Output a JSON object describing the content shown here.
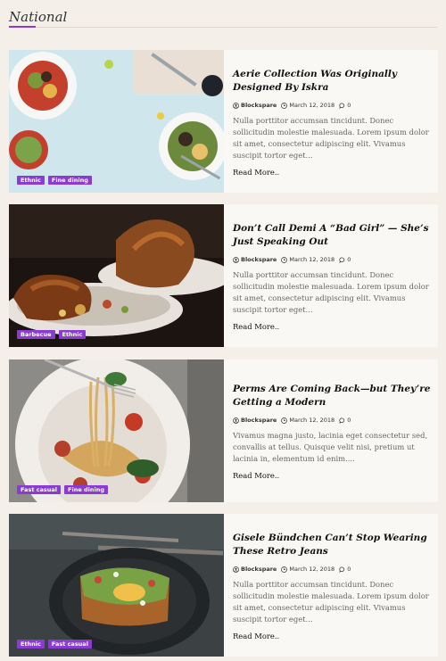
{
  "section": {
    "title": "National"
  },
  "colors": {
    "accent": "#8a3bd1",
    "background": "#f4efe8",
    "card": "#faf8f5"
  },
  "posts": [
    {
      "title": "Aerie Collection Was Originally Designed By Iskra",
      "author": "Blockspare",
      "date": "March 12, 2018",
      "comments": "0",
      "excerpt": "Nulla porttitor accumsan tincidunt. Donec sollicitudin molestie malesuada. Lorem ipsum dolor sit amet, consectetur adipiscing elit. Vivamus suscipit tortor eget...",
      "read_more": "Read More..",
      "tags": [
        "Ethnic",
        "Fine dining"
      ],
      "image_icon": "salad-plates-photo"
    },
    {
      "title": "Don’t Call Demi A “Bad Girl” — She’s Just Speaking Out",
      "author": "Blockspare",
      "date": "March 12, 2018",
      "comments": "0",
      "excerpt": "Nulla porttitor accumsan tincidunt. Donec sollicitudin molestie malesuada. Lorem ipsum dolor sit amet, consectetur adipiscing elit. Vivamus suscipit tortor eget...",
      "read_more": "Read More..",
      "tags": [
        "Barbecue",
        "Ethnic"
      ],
      "image_icon": "roast-chicken-photo"
    },
    {
      "title": "Perms Are Coming Back—but They’re Getting a Modern",
      "author": "Blockspare",
      "date": "March 12, 2018",
      "comments": "0",
      "excerpt": "Vivamus magna justo, lacinia eget consectetur sed, convallis at tellus. Quisque velit nisi, pretium ut lacinia in, elementum id enim....",
      "read_more": "Read More..",
      "tags": [
        "Fast casual",
        "Fine dining"
      ],
      "image_icon": "spaghetti-photo"
    },
    {
      "title": "Gisele Bündchen Can’t Stop Wearing These Retro Jeans",
      "author": "Blockspare",
      "date": "March 12, 2018",
      "comments": "0",
      "excerpt": "Nulla porttitor accumsan tincidunt. Donec sollicitudin molestie malesuada. Lorem ipsum dolor sit amet, consectetur adipiscing elit. Vivamus suscipit tortor eget...",
      "read_more": "Read More..",
      "tags": [
        "Ethnic",
        "Fast casual"
      ],
      "image_icon": "avocado-toast-photo"
    }
  ]
}
